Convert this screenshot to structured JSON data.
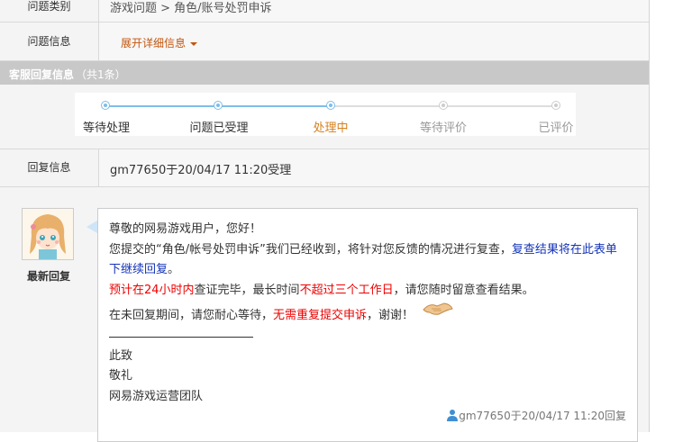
{
  "ticket": {
    "category_label": "问题类别",
    "category_value": "游戏问题 > 角色/账号处罚申诉",
    "info_label": "问题信息",
    "expand_label": "展开详细信息"
  },
  "section": {
    "title": "客服回复信息",
    "count": "（共1条）"
  },
  "progress": {
    "steps": [
      {
        "label": "等待处理",
        "state": "done"
      },
      {
        "label": "问题已受理",
        "state": "done"
      },
      {
        "label": "处理中",
        "state": "current"
      },
      {
        "label": "等待评价",
        "state": "todo"
      },
      {
        "label": "已评价",
        "state": "todo"
      }
    ]
  },
  "reply_info": {
    "label": "回复信息",
    "value": "gm77650于20/04/17 11:20受理"
  },
  "reply": {
    "latest_label": "最新回复",
    "greeting": "尊敬的网易游戏用户，您好！",
    "p1_a": "您提交的“角色/帐号处罚申诉”我们已经收到，将针对您反馈的情况进行复查，",
    "p1_b": "复查结果将在此表单下继续回复",
    "p1_c": "。",
    "p2_a": "预计在24小时内",
    "p2_b": "查证完毕，最长时间",
    "p2_c": "不超过三个工作日",
    "p2_d": "，请您随时留意查看结果。",
    "p3_a": "在未回复期间，请您耐心等待，",
    "p3_b": "无需重复提交申诉",
    "p3_c": "，谢谢！",
    "closing1": "此致",
    "closing2": "敬礼",
    "team": "网易游戏运营团队",
    "signature": "gm77650于20/04/17 11:20回复"
  },
  "colors": {
    "accent_orange": "#c2560e",
    "progress_blue": "#7fbde8",
    "highlight_red": "#e00000",
    "highlight_blue": "#1434b8",
    "section_bar": "#c8c8c8"
  }
}
